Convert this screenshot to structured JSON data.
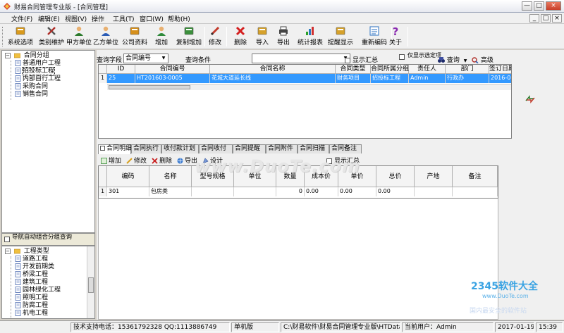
{
  "window": {
    "title": "财易合同管理专业版 - [合同管理]",
    "minimize_glyph": "—",
    "restore_glyph": "□",
    "close_glyph": "×"
  },
  "menu": {
    "items": [
      "文件(F)",
      "编辑(E)",
      "视图(V)",
      "操作",
      "工具(T)",
      "窗口(W)",
      "帮助(H)"
    ],
    "mdi_min": "_",
    "mdi_restore": "□",
    "mdi_close": "×"
  },
  "toolbar": {
    "items": [
      {
        "label": "系统选项",
        "icon": "options-icon",
        "color": "#d99a1c"
      },
      {
        "label": "类别维护",
        "icon": "tools-icon",
        "color": "#555555"
      },
      {
        "label": "甲方单位",
        "icon": "party-a-icon",
        "color": "#2c7a2c"
      },
      {
        "label": "乙方单位",
        "icon": "party-b-icon",
        "color": "#2b5cb5"
      },
      {
        "label": "公司资料",
        "icon": "company-icon",
        "color": "#d68f1a"
      },
      {
        "label": "增加",
        "icon": "add-icon",
        "color": "#2e8a3a"
      },
      {
        "label": "复制增加",
        "icon": "copy-add-icon",
        "color": "#3c8f3c"
      },
      {
        "label": "修改",
        "icon": "edit-pencil-icon",
        "color": "#c23a2a"
      },
      {
        "label": "删除",
        "icon": "delete-x-icon",
        "color": "#d42020"
      },
      {
        "label": "导入",
        "icon": "import-icon",
        "color": "#d6a12a"
      },
      {
        "label": "导出",
        "icon": "export-printer-icon",
        "color": "#444444"
      },
      {
        "label": "统计报表",
        "icon": "report-chart-icon",
        "color": "#2a7ac0"
      },
      {
        "label": "提醒显示",
        "icon": "reminder-icon",
        "color": "#d6a12a"
      },
      {
        "label": "重新编码",
        "icon": "recode-icon",
        "color": "#2a6fc0"
      },
      {
        "label": "关于",
        "icon": "help-question-icon",
        "color": "#8a2bb0"
      }
    ]
  },
  "left_tree": {
    "root": "合同分组",
    "items": [
      "普通用户工程",
      "招投标工程",
      "内部自行工程",
      "采购合同",
      "销售合同"
    ]
  },
  "left_mid": {
    "label": "导航自动组合分组查询"
  },
  "left_bottom_tree": {
    "root": "工程类型",
    "items": [
      "道路工程",
      "开发前期类",
      "桥梁工程",
      "建筑工程",
      "园林绿化工程",
      "照明工程",
      "防腐工程",
      "机电工程"
    ]
  },
  "query": {
    "field_label": "查询字段",
    "field_value": "合同编号",
    "condition_label": "查询条件",
    "condition_value": "",
    "show_summary": "显示汇总",
    "only_show_unfinished": "仅显示选定项",
    "query_button": "查询",
    "advanced_button": "高级"
  },
  "contracts_table": {
    "columns": [
      "ID",
      "合同编号",
      "合同名称",
      "合同类型",
      "合同所属分组",
      "责任人",
      "部门",
      "签订日期"
    ],
    "rows": [
      {
        "row_num": "1",
        "id": "25",
        "code": "HT201603-0005",
        "name": "花城大道延长线",
        "type": "财务项目",
        "group": "招投标工程",
        "owner": "Admin",
        "dept": "行政办",
        "date": "2016-03-2"
      }
    ]
  },
  "tabs": {
    "items": [
      "合同明细",
      "合同执行",
      "收付款计划",
      "合同收付",
      "合同提醒",
      "合同附件",
      "合同扫描",
      "合同备注"
    ],
    "active_index": 0
  },
  "sub_toolbar": {
    "add": "增加",
    "edit": "修改",
    "delete": "删除",
    "export": "导出",
    "design": "设计",
    "show_summary": "显示汇总"
  },
  "detail_table": {
    "columns": [
      "编码",
      "名称",
      "型号规格",
      "单位",
      "数量",
      "成本价",
      "单价",
      "总价",
      "产地",
      "备注"
    ],
    "rows": [
      {
        "row_num": "1",
        "code": "301",
        "name": "包房类",
        "spec": "",
        "unit": "",
        "qty": "0",
        "cost": "0.00",
        "price": "0.00",
        "total": "0.00",
        "origin": "",
        "remark": ""
      }
    ]
  },
  "watermark": {
    "main": "www.DuoTe.com",
    "corner_big": "2345软件大全",
    "corner_small": "www.DuoTe.com",
    "corner_faded": "国内最安全的软件站"
  },
  "statusbar": {
    "support": "技术支持电话：15361792328 QQ:1113886749",
    "edition": "单机版",
    "path": "C:\\财易软件\\财易合同管理专业版\\HTData.sys",
    "user": "当前用户：Admin",
    "date": "2017-01-19",
    "time": "15:39"
  },
  "colors": {
    "selection": "#3399ff",
    "chrome": "#f0f0f0"
  }
}
